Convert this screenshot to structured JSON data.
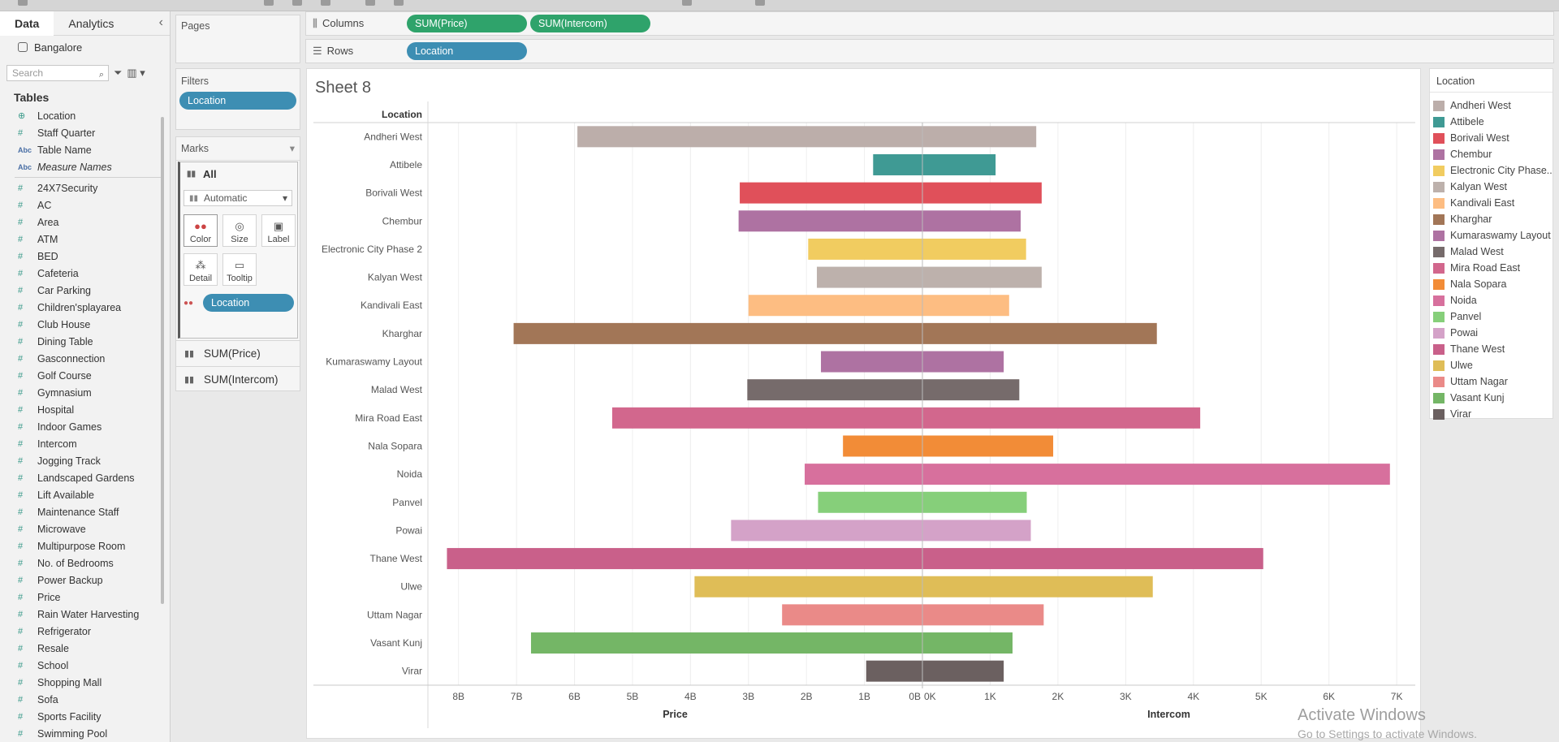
{
  "datapane": {
    "tabs": [
      "Data",
      "Analytics"
    ],
    "source": "Bangalore",
    "search_placeholder": "Search",
    "tables_heading": "Tables",
    "dim_fields": [
      {
        "name": "Location",
        "type": "geo"
      },
      {
        "name": "Staff Quarter",
        "type": "num"
      },
      {
        "name": "Table Name",
        "type": "abc"
      },
      {
        "name": "Measure Names",
        "type": "abc"
      }
    ],
    "measure_fields": [
      "24X7Security",
      "AC",
      "Area",
      "ATM",
      "BED",
      "Cafeteria",
      "Car Parking",
      "Children'splayarea",
      "Club House",
      "Dining Table",
      "Gasconnection",
      "Golf Course",
      "Gymnasium",
      "Hospital",
      "Indoor Games",
      "Intercom",
      "Jogging Track",
      "Landscaped Gardens",
      "Lift Available",
      "Maintenance Staff",
      "Microwave",
      "Multipurpose Room",
      "No. of Bedrooms",
      "Power Backup",
      "Price",
      "Rain Water Harvesting",
      "Refrigerator",
      "Resale",
      "School",
      "Shopping Mall",
      "Sofa",
      "Sports Facility",
      "Swimming Pool"
    ]
  },
  "pages": {
    "title": "Pages"
  },
  "filters": {
    "title": "Filters",
    "pill": "Location"
  },
  "marks": {
    "title": "Marks",
    "all_label": "All",
    "type_select": "Automatic",
    "buttons": {
      "color": "Color",
      "size": "Size",
      "label": "Label",
      "detail": "Detail",
      "tooltip": "Tooltip"
    },
    "color_pill": "Location",
    "rows": [
      "SUM(Price)",
      "SUM(Intercom)"
    ]
  },
  "shelves": {
    "columns_label": "Columns",
    "columns_pills": [
      "SUM(Price)",
      "SUM(Intercom)"
    ],
    "rows_label": "Rows",
    "rows_pills": [
      "Location"
    ]
  },
  "sheet_title": "Sheet 8",
  "legend": {
    "title": "Location"
  },
  "watermark": {
    "line1": "Activate Windows",
    "line2": "Go to Settings to activate Windows."
  },
  "chart_data": {
    "type": "bar",
    "row_header": "Location",
    "categories": [
      "Andheri West",
      "Attibele",
      "Borivali West",
      "Chembur",
      "Electronic City Phase 2",
      "Kalyan West",
      "Kandivali East",
      "Kharghar",
      "Kumaraswamy Layout",
      "Malad West",
      "Mira Road East",
      "Nala Sopara",
      "Noida",
      "Panvel",
      "Powai",
      "Thane West",
      "Ulwe",
      "Uttam Nagar",
      "Vasant Kunj",
      "Virar"
    ],
    "legend_labels": [
      "Andheri West",
      "Attibele",
      "Borivali West",
      "Chembur",
      "Electronic City Phase...",
      "Kalyan West",
      "Kandivali East",
      "Kharghar",
      "Kumaraswamy Layout",
      "Malad West",
      "Mira Road East",
      "Nala Sopara",
      "Noida",
      "Panvel",
      "Powai",
      "Thane West",
      "Ulwe",
      "Uttam Nagar",
      "Vasant Kunj",
      "Virar"
    ],
    "colors": [
      "#bcaeaa",
      "#3f9a94",
      "#e0505a",
      "#ae72a2",
      "#f1cc60",
      "#bdb1ac",
      "#fdbd82",
      "#a27657",
      "#ae72a2",
      "#766b6b",
      "#d2678d",
      "#f28c37",
      "#d7709d",
      "#86cf7a",
      "#d4a2c8",
      "#c9608a",
      "#dfbd57",
      "#ea8a88",
      "#74b666",
      "#6b6060"
    ],
    "series": [
      {
        "name": "Price",
        "reversed": true,
        "xlim": [
          0,
          8.5
        ],
        "ticks": [
          0,
          1,
          2,
          3,
          4,
          5,
          6,
          7,
          8
        ],
        "tick_labels": [
          "0B",
          "1B",
          "2B",
          "3B",
          "4B",
          "5B",
          "6B",
          "7B",
          "8B"
        ],
        "values": [
          5.95,
          0.85,
          3.15,
          3.17,
          1.97,
          1.82,
          3.0,
          7.05,
          1.75,
          3.02,
          5.35,
          1.37,
          2.03,
          1.8,
          3.3,
          8.2,
          3.93,
          2.42,
          6.75,
          0.97
        ]
      },
      {
        "name": "Intercom",
        "reversed": false,
        "xlim": [
          0,
          7.25
        ],
        "ticks": [
          0,
          1,
          2,
          3,
          4,
          5,
          6,
          7
        ],
        "tick_labels": [
          "0K",
          "1K",
          "2K",
          "3K",
          "4K",
          "5K",
          "6K",
          "7K"
        ],
        "values": [
          1.68,
          1.08,
          1.76,
          1.45,
          1.53,
          1.76,
          1.28,
          3.46,
          1.2,
          1.43,
          4.1,
          1.93,
          6.9,
          1.54,
          1.6,
          5.03,
          3.4,
          1.79,
          1.33,
          1.2
        ]
      }
    ],
    "grid": true
  }
}
